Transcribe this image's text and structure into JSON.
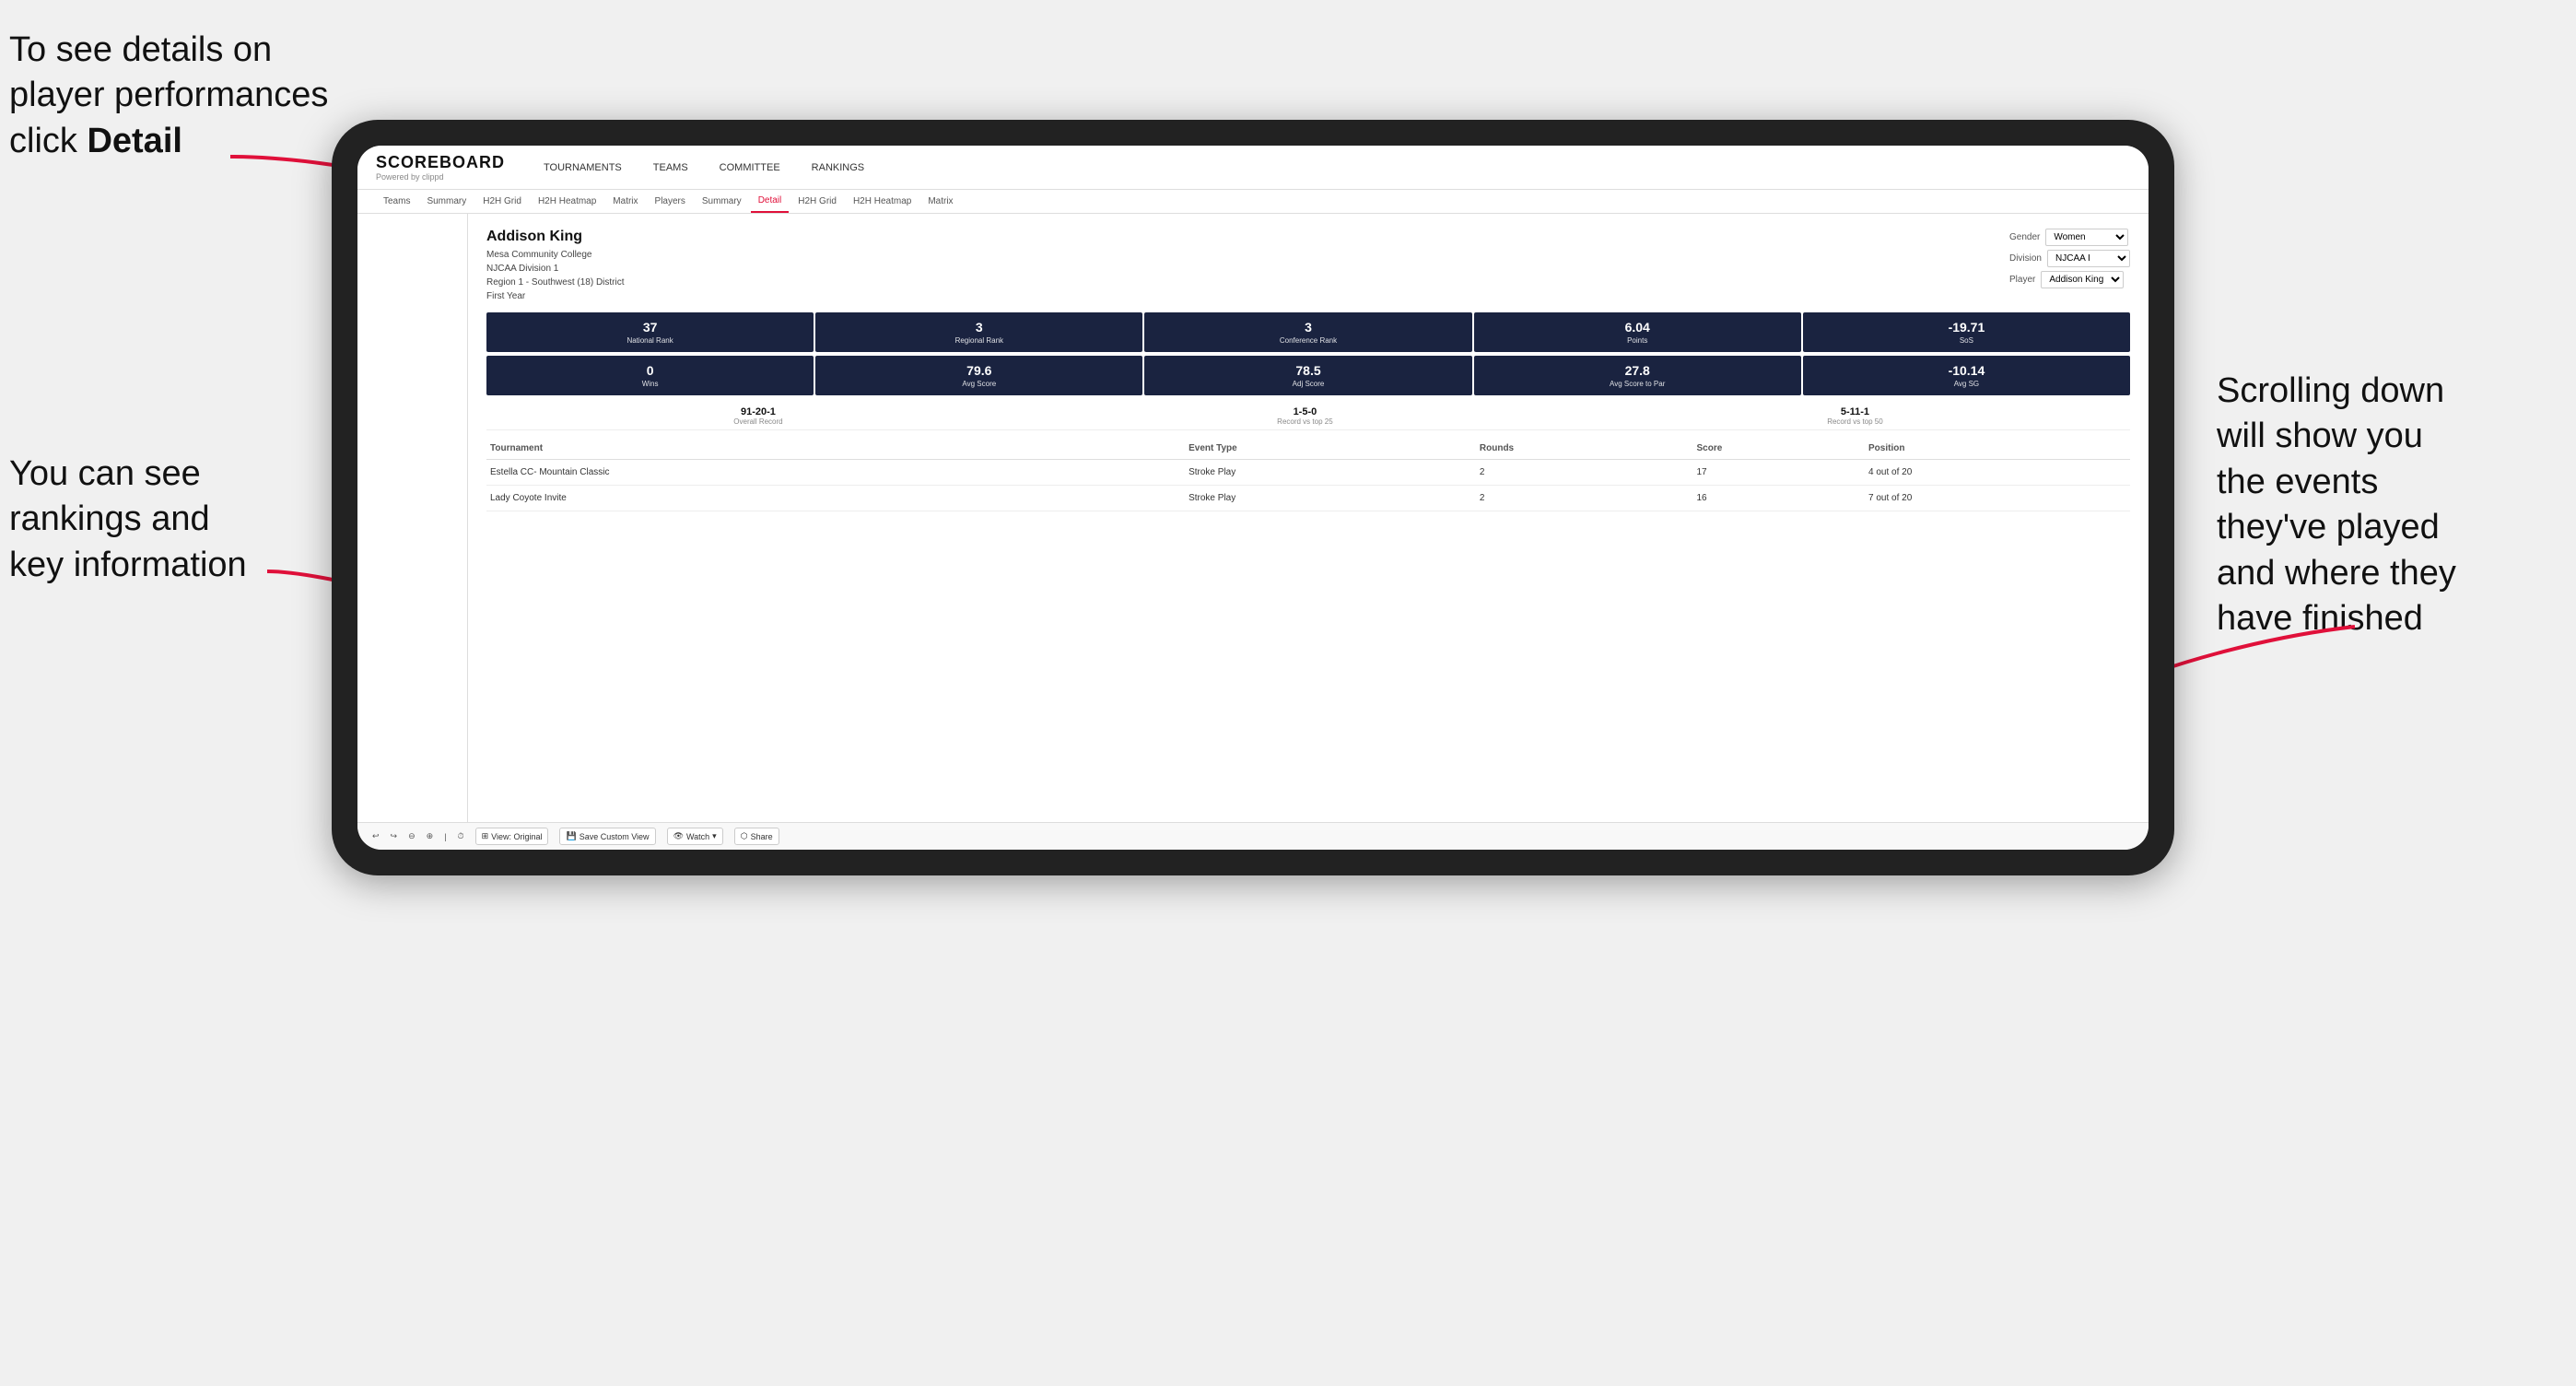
{
  "annotations": {
    "topleft": "To see details on player performances click ",
    "topleft_bold": "Detail",
    "bottomleft_line1": "You can see",
    "bottomleft_line2": "rankings and",
    "bottomleft_line3": "key information",
    "right_line1": "Scrolling down",
    "right_line2": "will show you",
    "right_line3": "the events",
    "right_line4": "they've played",
    "right_line5": "and where they",
    "right_line6": "have finished"
  },
  "nav": {
    "logo_main": "SCOREBOARD",
    "logo_sub": "Powered by clippd",
    "items": [
      "TOURNAMENTS",
      "TEAMS",
      "COMMITTEE",
      "RANKINGS"
    ]
  },
  "subnav": {
    "items": [
      "Teams",
      "Summary",
      "H2H Grid",
      "H2H Heatmap",
      "Matrix",
      "Players",
      "Summary",
      "Detail",
      "H2H Grid",
      "H2H Heatmap",
      "Matrix"
    ],
    "active": "Detail"
  },
  "player": {
    "name": "Addison King",
    "college": "Mesa Community College",
    "division": "NJCAA Division 1",
    "region": "Region 1 - Southwest (18) District",
    "year": "First Year"
  },
  "filters": {
    "gender_label": "Gender",
    "gender_value": "Women",
    "division_label": "Division",
    "division_value": "NJCAA I",
    "player_label": "Player",
    "player_value": "Addison King"
  },
  "stats_row1": [
    {
      "value": "37",
      "label": "National Rank"
    },
    {
      "value": "3",
      "label": "Regional Rank"
    },
    {
      "value": "3",
      "label": "Conference Rank"
    },
    {
      "value": "6.04",
      "label": "Points"
    },
    {
      "value": "-19.71",
      "label": "SoS"
    }
  ],
  "stats_row2": [
    {
      "value": "0",
      "label": "Wins"
    },
    {
      "value": "79.6",
      "label": "Avg Score"
    },
    {
      "value": "78.5",
      "label": "Adj Score"
    },
    {
      "value": "27.8",
      "label": "Avg Score to Par"
    },
    {
      "value": "-10.14",
      "label": "Avg SG"
    }
  ],
  "records": [
    {
      "value": "91-20-1",
      "label": "Overall Record"
    },
    {
      "value": "1-5-0",
      "label": "Record vs top 25"
    },
    {
      "value": "5-11-1",
      "label": "Record vs top 50"
    }
  ],
  "table": {
    "headers": [
      "Tournament",
      "",
      "Event Type",
      "Rounds",
      "Score",
      "Position"
    ],
    "rows": [
      {
        "tournament": "Estella CC- Mountain Classic",
        "event_type": "Stroke Play",
        "rounds": "2",
        "score": "17",
        "position": "4 out of 20"
      },
      {
        "tournament": "Lady Coyote Invite",
        "event_type": "Stroke Play",
        "rounds": "2",
        "score": "16",
        "position": "7 out of 20"
      }
    ]
  },
  "toolbar": {
    "view_original": "View: Original",
    "save_custom": "Save Custom View",
    "watch": "Watch",
    "share": "Share"
  }
}
